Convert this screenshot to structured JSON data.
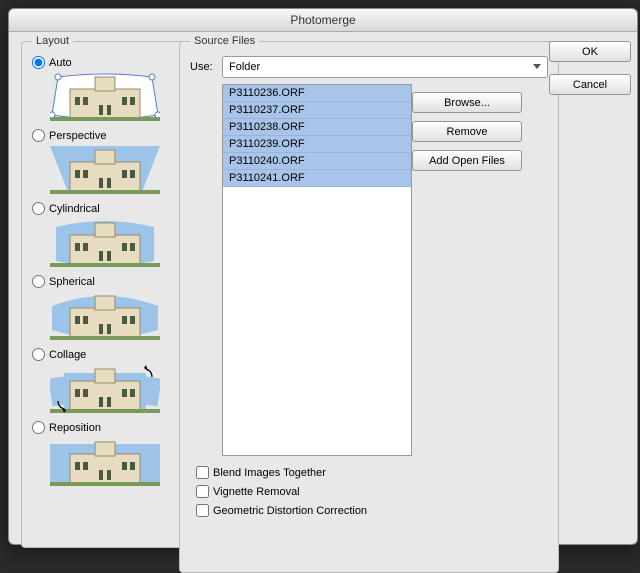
{
  "title": "Photomerge",
  "btns": {
    "ok": "OK",
    "cancel": "Cancel"
  },
  "layout": {
    "title": "Layout",
    "opts": [
      "Auto",
      "Perspective",
      "Cylindrical",
      "Spherical",
      "Collage",
      "Reposition"
    ],
    "selected": 0
  },
  "source": {
    "title": "Source Files",
    "use_label": "Use:",
    "use_value": "Folder",
    "files": [
      "P3110236.ORF",
      "P3110237.ORF",
      "P3110238.ORF",
      "P3110239.ORF",
      "P3110240.ORF",
      "P3110241.ORF"
    ],
    "browse": "Browse...",
    "remove": "Remove",
    "addopen": "Add Open Files",
    "blend": "Blend Images Together",
    "vignette": "Vignette Removal",
    "geom": "Geometric Distortion Correction"
  }
}
